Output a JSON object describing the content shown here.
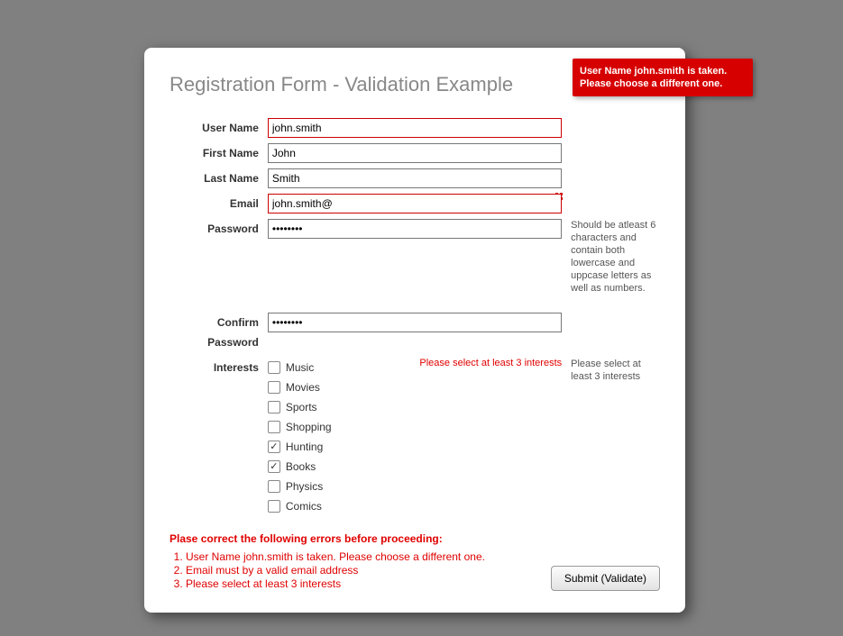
{
  "title": "Registration Form - Validation Example",
  "fields": {
    "username": {
      "label": "User Name",
      "value": "john.smith",
      "invalid": true
    },
    "firstname": {
      "label": "First Name",
      "value": "John",
      "invalid": false
    },
    "lastname": {
      "label": "Last Name",
      "value": "Smith",
      "invalid": false
    },
    "email": {
      "label": "Email",
      "value": "john.smith@",
      "invalid": true
    },
    "password": {
      "label": "Password",
      "value": "••••••••",
      "invalid": false,
      "hint": "Should be atleast 6 characters and contain both lowercase and uppcase letters as well as numbers."
    },
    "confirm": {
      "label": "Confirm Password",
      "value": "••••••••",
      "invalid": false
    },
    "interests": {
      "label": "Interests",
      "inline_error": "Please select at least 3 interests",
      "hint": "Please select at least 3 interests",
      "options": [
        {
          "label": "Music",
          "checked": false
        },
        {
          "label": "Movies",
          "checked": false
        },
        {
          "label": "Sports",
          "checked": false
        },
        {
          "label": "Shopping",
          "checked": false
        },
        {
          "label": "Hunting",
          "checked": true
        },
        {
          "label": "Books",
          "checked": true
        },
        {
          "label": "Physics",
          "checked": false
        },
        {
          "label": "Comics",
          "checked": false
        }
      ]
    }
  },
  "tooltip": "User Name john.smith is taken. Please choose a different one.",
  "summary": {
    "title": "Plase correct the following errors before proceeding:",
    "errors": [
      "User Name john.smith is taken. Please choose a different one.",
      "Email must by a valid email address",
      "Please select at least 3 interests"
    ]
  },
  "submit_label": "Submit (Validate)"
}
